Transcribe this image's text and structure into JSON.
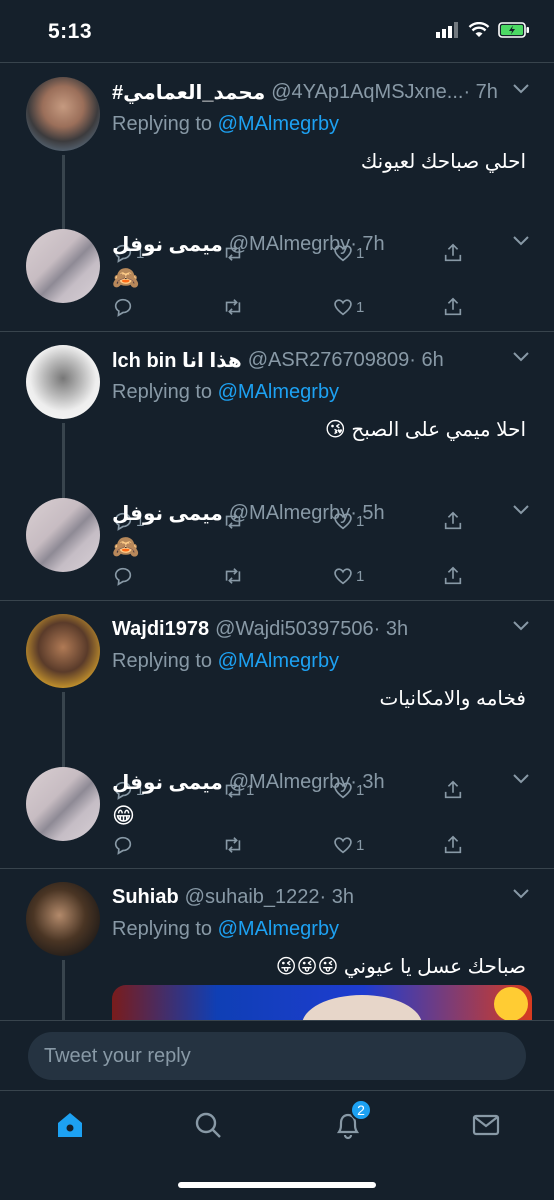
{
  "status_bar": {
    "time": "5:13"
  },
  "tweets": [
    {
      "name": "#محمد_العمامي",
      "handle": "@4YAp1AqMSJxne...",
      "time": "· 7h",
      "replying_prefix": "Replying to ",
      "replying_to": "@MAlmegrby",
      "text": "احلي صباحك لعيونك",
      "reply_count": "1",
      "retweet_count": "",
      "like_count": "1"
    },
    {
      "name": "ميمى نوفل",
      "handle": "@MAlmegrby",
      "time": "· 7h",
      "text": "🙈",
      "reply_count": "",
      "retweet_count": "",
      "like_count": "1"
    },
    {
      "name": "lch bin هذا انا",
      "handle": "@ASR276709809",
      "time": "· 6h",
      "replying_prefix": "Replying to ",
      "replying_to": "@MAlmegrby",
      "text": "احلا ميمي على الصبح 😘",
      "reply_count": "1",
      "retweet_count": "",
      "like_count": "1"
    },
    {
      "name": "ميمى نوفل",
      "handle": "@MAlmegrby",
      "time": "· 5h",
      "text": "🙈",
      "reply_count": "",
      "retweet_count": "",
      "like_count": "1"
    },
    {
      "name": "Wajdi1978",
      "handle": "@Wajdi50397506",
      "time": "· 3h",
      "replying_prefix": "Replying to ",
      "replying_to": "@MAlmegrby",
      "text": "فخامه والامكانيات",
      "reply_count": "1",
      "retweet_count": "1",
      "like_count": "1"
    },
    {
      "name": "ميمى نوفل",
      "handle": "@MAlmegrby",
      "time": "· 3h",
      "text": "😁",
      "reply_count": "",
      "retweet_count": "",
      "like_count": "1"
    },
    {
      "name": "Suhiab",
      "handle": "@suhaib_1222",
      "time": "· 3h",
      "replying_prefix": "Replying to ",
      "replying_to": "@MAlmegrby",
      "text": "صباحك عسل يا عيوني 😜😜😜"
    }
  ],
  "reply_bar": {
    "placeholder": "Tweet your reply"
  },
  "tab_bar": {
    "notifications_badge": "2"
  },
  "colors": {
    "background": "#15202b",
    "accent": "#1da1f2",
    "secondary_text": "#8899a6",
    "divider": "#38444d"
  }
}
